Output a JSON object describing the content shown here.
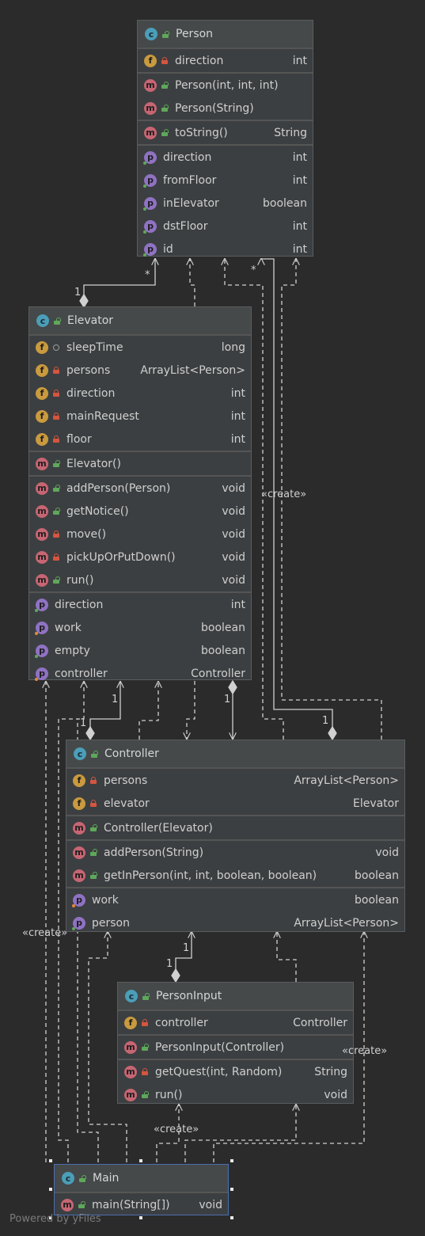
{
  "classes": {
    "person": {
      "name": "Person",
      "icon": "class-icon",
      "fields": [
        {
          "vis": "private",
          "name": "direction",
          "type": "int"
        }
      ],
      "constructors": [
        {
          "vis": "public",
          "name": "Person(int, int, int)",
          "type": ""
        },
        {
          "vis": "public",
          "name": "Person(String)",
          "type": ""
        }
      ],
      "methods": [
        {
          "vis": "public",
          "name": "toString()",
          "type": "String"
        }
      ],
      "properties": [
        {
          "name": "direction",
          "type": "int"
        },
        {
          "name": "fromFloor",
          "type": "int"
        },
        {
          "name": "inElevator",
          "type": "boolean"
        },
        {
          "name": "dstFloor",
          "type": "int"
        },
        {
          "name": "id",
          "type": "int"
        }
      ]
    },
    "elevator": {
      "name": "Elevator",
      "icon": "class-icon",
      "fields": [
        {
          "vis": "package",
          "name": "sleepTime",
          "type": "long"
        },
        {
          "vis": "private",
          "name": "persons",
          "type": "ArrayList<Person>"
        },
        {
          "vis": "private",
          "name": "direction",
          "type": "int"
        },
        {
          "vis": "private",
          "name": "mainRequest",
          "type": "int"
        },
        {
          "vis": "private",
          "name": "floor",
          "type": "int"
        }
      ],
      "constructors": [
        {
          "vis": "public",
          "name": "Elevator()",
          "type": ""
        }
      ],
      "methods": [
        {
          "vis": "public",
          "name": "addPerson(Person)",
          "type": "void"
        },
        {
          "vis": "public",
          "name": "getNotice()",
          "type": "void"
        },
        {
          "vis": "private",
          "name": "move()",
          "type": "void"
        },
        {
          "vis": "private",
          "name": "pickUpOrPutDown()",
          "type": "void"
        },
        {
          "vis": "public",
          "name": "run()",
          "type": "void"
        }
      ],
      "properties": [
        {
          "name": "direction",
          "type": "int"
        },
        {
          "name": "work",
          "type": "boolean"
        },
        {
          "name": "empty",
          "type": "boolean"
        },
        {
          "name": "controller",
          "type": "Controller"
        }
      ]
    },
    "controller": {
      "name": "Controller",
      "icon": "class-icon",
      "fields": [
        {
          "vis": "private",
          "name": "persons",
          "type": "ArrayList<Person>"
        },
        {
          "vis": "private",
          "name": "elevator",
          "type": "Elevator"
        }
      ],
      "constructors": [
        {
          "vis": "public",
          "name": "Controller(Elevator)",
          "type": ""
        }
      ],
      "methods": [
        {
          "vis": "public",
          "name": "addPerson(String)",
          "type": "void"
        },
        {
          "vis": "public",
          "name": "getInPerson(int, int, boolean, boolean)",
          "type": "boolean"
        }
      ],
      "properties": [
        {
          "name": "work",
          "type": "boolean"
        },
        {
          "name": "person",
          "type": "ArrayList<Person>"
        }
      ]
    },
    "personinput": {
      "name": "PersonInput",
      "icon": "class-icon",
      "fields": [
        {
          "vis": "private",
          "name": "controller",
          "type": "Controller"
        }
      ],
      "constructors": [
        {
          "vis": "public",
          "name": "PersonInput(Controller)",
          "type": ""
        }
      ],
      "methods": [
        {
          "vis": "private",
          "name": "getQuest(int, Random)",
          "type": "String"
        },
        {
          "vis": "public",
          "name": "run()",
          "type": "void"
        }
      ],
      "properties": []
    },
    "main": {
      "name": "Main",
      "icon": "class-icon",
      "fields": [],
      "constructors": [],
      "methods": [
        {
          "vis": "public",
          "name": "main(String[])",
          "type": "void"
        }
      ],
      "properties": []
    }
  },
  "edge_labels": {
    "create_1": "«create»",
    "create_2": "«create»",
    "create_3": "«create»",
    "create_4": "«create»",
    "mult_person_elev_one": "1",
    "mult_person_elev_many": "*",
    "mult_person_ctrl_many": "*",
    "mult_ctrl_person_one": "1",
    "mult_elev_ctrl_1": "1",
    "mult_elev_ctrl_2": "1",
    "mult_ctrl_elev": "1",
    "mult_ctrl_pi_1": "1",
    "mult_ctrl_pi_2": "1"
  },
  "footer": "Powered by yFiles",
  "colors": {
    "background": "#2b2b2b",
    "class_icon": "#4b9eb8",
    "field_icon": "#c99a3e",
    "method_icon": "#c76573",
    "property_icon": "#8f72c2",
    "public": "#5fa85a",
    "private": "#d5553f",
    "edge": "#d0d0d0"
  }
}
